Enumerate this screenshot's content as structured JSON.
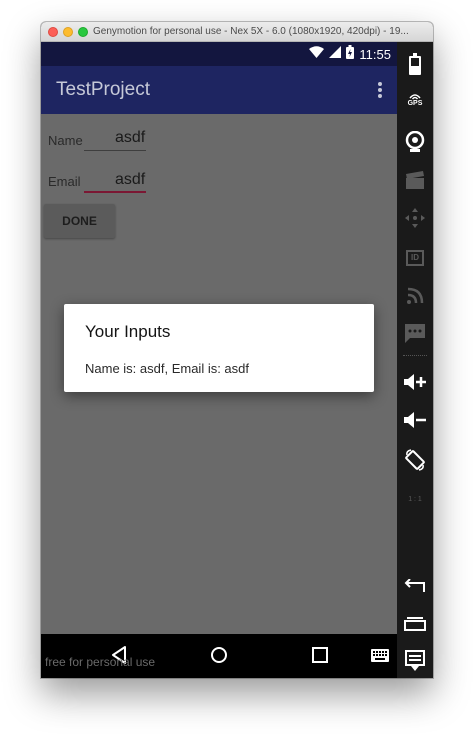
{
  "window": {
    "title": "Genymotion for personal use - Nex 5X - 6.0 (1080x1920, 420dpi) - 19..."
  },
  "statusbar": {
    "time": "11:55"
  },
  "appbar": {
    "title": "TestProject"
  },
  "form": {
    "name_label": "Name",
    "name_value": "asdf",
    "email_label": "Email",
    "email_value": "asdf",
    "done_label": "DONE"
  },
  "dialog": {
    "title": "Your Inputs",
    "message": "Name is: asdf, Email is: asdf"
  },
  "watermark": "free for personal use",
  "sidebar": {
    "gps_label": "GPS",
    "id_label": "ID",
    "ratio_label": "1 : 1"
  },
  "colors": {
    "statusbar": "#13163f",
    "appbar": "#1e2561",
    "accent": "#7b1733",
    "scrim_background": "#6a6a6a"
  }
}
